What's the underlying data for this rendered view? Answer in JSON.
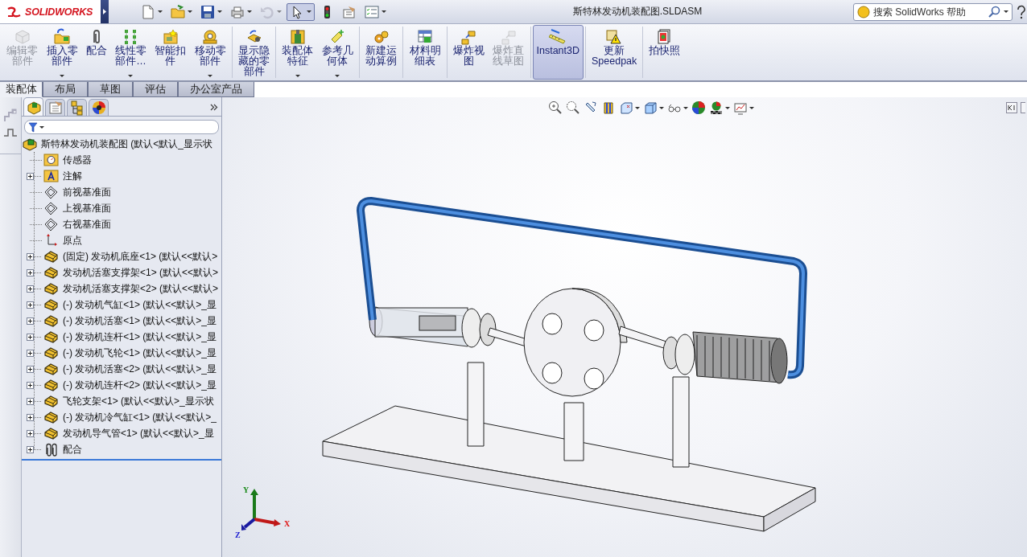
{
  "app": {
    "brand": "SOLIDWORKS"
  },
  "window": {
    "title": "斯特林发动机装配图.SLDASM"
  },
  "quick_access": [
    {
      "dropdown": true,
      "disabled": false,
      "pressed": false
    },
    {
      "dropdown": true,
      "disabled": false,
      "pressed": false
    },
    {
      "dropdown": true,
      "disabled": false,
      "pressed": false
    },
    {
      "dropdown": true,
      "disabled": false,
      "pressed": false
    },
    {
      "dropdown": true,
      "disabled": true,
      "pressed": false
    },
    {
      "dropdown": true,
      "disabled": false,
      "pressed": true
    },
    {
      "dropdown": false,
      "disabled": false,
      "pressed": false
    },
    {
      "dropdown": false,
      "disabled": false,
      "pressed": false
    },
    {
      "dropdown": true,
      "disabled": false,
      "pressed": false
    }
  ],
  "search": {
    "placeholder": "搜索 SolidWorks 帮助"
  },
  "ribbon": {
    "buttons": [
      {
        "label": "编辑零部件",
        "disabled": true,
        "dropdown": false,
        "selected": false
      },
      {
        "label": "插入零部件",
        "disabled": false,
        "dropdown": true,
        "selected": false
      },
      {
        "label": "配合",
        "disabled": false,
        "dropdown": false,
        "selected": false
      },
      {
        "label": "线性零部件…",
        "disabled": false,
        "dropdown": true,
        "selected": false
      },
      {
        "label": "智能扣件",
        "disabled": false,
        "dropdown": false,
        "selected": false
      },
      {
        "label": "移动零部件",
        "disabled": false,
        "dropdown": true,
        "selected": false
      },
      {
        "label": "显示隐藏的零部件",
        "disabled": false,
        "dropdown": false,
        "selected": false
      },
      {
        "label": "装配体特征",
        "disabled": false,
        "dropdown": true,
        "selected": false
      },
      {
        "label": "参考几何体",
        "disabled": false,
        "dropdown": true,
        "selected": false
      },
      {
        "label": "新建运动算例",
        "disabled": false,
        "dropdown": false,
        "selected": false
      },
      {
        "label": "材料明细表",
        "disabled": false,
        "dropdown": false,
        "selected": false
      },
      {
        "label": "爆炸视图",
        "disabled": false,
        "dropdown": false,
        "selected": false
      },
      {
        "label": "爆炸直线草图",
        "disabled": true,
        "dropdown": false,
        "selected": false
      },
      {
        "label": "Instant3D",
        "disabled": false,
        "dropdown": false,
        "selected": true
      },
      {
        "label": "更新 Speedpak",
        "disabled": false,
        "dropdown": false,
        "selected": false
      },
      {
        "label": "拍快照",
        "disabled": false,
        "dropdown": false,
        "selected": false
      }
    ]
  },
  "tabs": [
    {
      "label": "装配体",
      "selected": true
    },
    {
      "label": "布局",
      "selected": false
    },
    {
      "label": "草图",
      "selected": false
    },
    {
      "label": "评估",
      "selected": false
    },
    {
      "label": "办公室产品",
      "selected": false
    }
  ],
  "panel_tabs": [
    {
      "selected": true
    },
    {
      "selected": false
    },
    {
      "selected": false
    },
    {
      "selected": false
    }
  ],
  "tree": {
    "label": "斯特林发动机装配图  (默认<默认_显示状",
    "children": [
      {
        "kind": "sensor",
        "label": "传感器",
        "expandable": false
      },
      {
        "kind": "annotation",
        "label": "注解",
        "expandable": true
      },
      {
        "kind": "plane",
        "label": "前视基准面",
        "expandable": false
      },
      {
        "kind": "plane",
        "label": "上视基准面",
        "expandable": false
      },
      {
        "kind": "plane",
        "label": "右视基准面",
        "expandable": false
      },
      {
        "kind": "origin",
        "label": "原点",
        "expandable": false
      },
      {
        "kind": "part",
        "label": "(固定) 发动机底座<1> (默认<<默认>",
        "expandable": true
      },
      {
        "kind": "part",
        "label": "发动机活塞支撑架<1> (默认<<默认>",
        "expandable": true
      },
      {
        "kind": "part",
        "label": "发动机活塞支撑架<2> (默认<<默认>",
        "expandable": true
      },
      {
        "kind": "part",
        "label": "(-) 发动机气缸<1> (默认<<默认>_显",
        "expandable": true
      },
      {
        "kind": "part",
        "label": "(-) 发动机活塞<1> (默认<<默认>_显",
        "expandable": true
      },
      {
        "kind": "part",
        "label": "(-) 发动机连杆<1> (默认<<默认>_显",
        "expandable": true
      },
      {
        "kind": "part",
        "label": "(-) 发动机飞轮<1> (默认<<默认>_显",
        "expandable": true
      },
      {
        "kind": "part",
        "label": "(-) 发动机活塞<2> (默认<<默认>_显",
        "expandable": true
      },
      {
        "kind": "part",
        "label": "(-) 发动机连杆<2> (默认<<默认>_显",
        "expandable": true
      },
      {
        "kind": "part",
        "label": "飞轮支架<1> (默认<<默认>_显示状",
        "expandable": true
      },
      {
        "kind": "part",
        "label": "(-) 发动机冷气缸<1> (默认<<默认>_",
        "expandable": true
      },
      {
        "kind": "part",
        "label": "发动机导气管<1> (默认<<默认>_显",
        "expandable": true
      },
      {
        "kind": "mates",
        "label": "配合",
        "expandable": true
      }
    ]
  },
  "view_toolbar": [
    {
      "dropdown": false
    },
    {
      "dropdown": false
    },
    {
      "dropdown": false
    },
    {
      "dropdown": false
    },
    {
      "dropdown": true
    },
    {
      "dropdown": true
    },
    {
      "dropdown": true
    },
    {
      "dropdown": false
    },
    {
      "dropdown": true
    },
    {
      "dropdown": true
    }
  ],
  "triad": {
    "labels": [
      "X",
      "Y",
      "Z"
    ]
  }
}
